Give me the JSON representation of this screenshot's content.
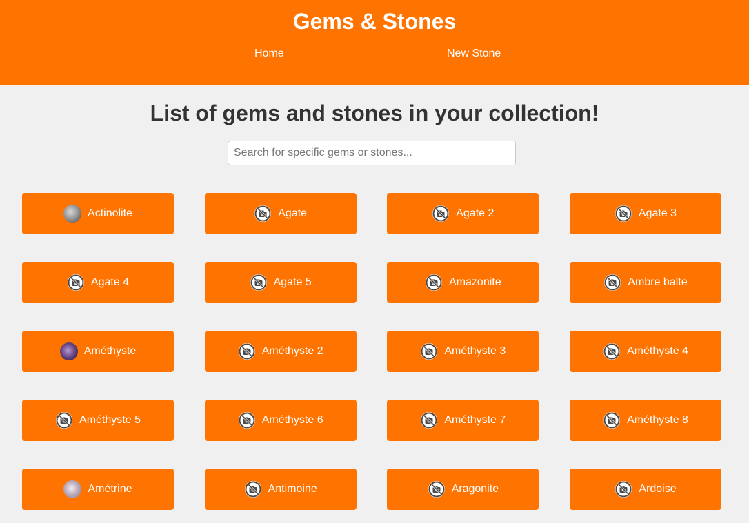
{
  "header": {
    "title": "Gems & Stones",
    "nav": [
      {
        "label": "Home"
      },
      {
        "label": "New Stone"
      }
    ]
  },
  "main": {
    "heading": "List of gems and stones in your collection!",
    "search": {
      "placeholder": "Search for specific gems or stones...",
      "value": ""
    },
    "stones": [
      {
        "name": "Actinolite",
        "icon": "stone-photo-gray"
      },
      {
        "name": "Agate",
        "icon": "no-photo-icon"
      },
      {
        "name": "Agate 2",
        "icon": "no-photo-icon"
      },
      {
        "name": "Agate 3",
        "icon": "no-photo-icon"
      },
      {
        "name": "Agate 4",
        "icon": "no-photo-icon"
      },
      {
        "name": "Agate 5",
        "icon": "no-photo-icon"
      },
      {
        "name": "Amazonite",
        "icon": "no-photo-icon"
      },
      {
        "name": "Ambre balte",
        "icon": "no-photo-icon"
      },
      {
        "name": "Améthyste",
        "icon": "stone-photo-purple"
      },
      {
        "name": "Améthyste 2",
        "icon": "no-photo-icon"
      },
      {
        "name": "Améthyste 3",
        "icon": "no-photo-icon"
      },
      {
        "name": "Améthyste 4",
        "icon": "no-photo-icon"
      },
      {
        "name": "Améthyste 5",
        "icon": "no-photo-icon"
      },
      {
        "name": "Améthyste 6",
        "icon": "no-photo-icon"
      },
      {
        "name": "Améthyste 7",
        "icon": "no-photo-icon"
      },
      {
        "name": "Améthyste 8",
        "icon": "no-photo-icon"
      },
      {
        "name": "Amétrine",
        "icon": "stone-photo-pale"
      },
      {
        "name": "Antimoine",
        "icon": "no-photo-icon"
      },
      {
        "name": "Aragonite",
        "icon": "no-photo-icon"
      },
      {
        "name": "Ardoise",
        "icon": "no-photo-icon"
      }
    ]
  },
  "colors": {
    "accent": "#ff7300",
    "background": "#f0f0f0",
    "heading_text": "#333333"
  }
}
